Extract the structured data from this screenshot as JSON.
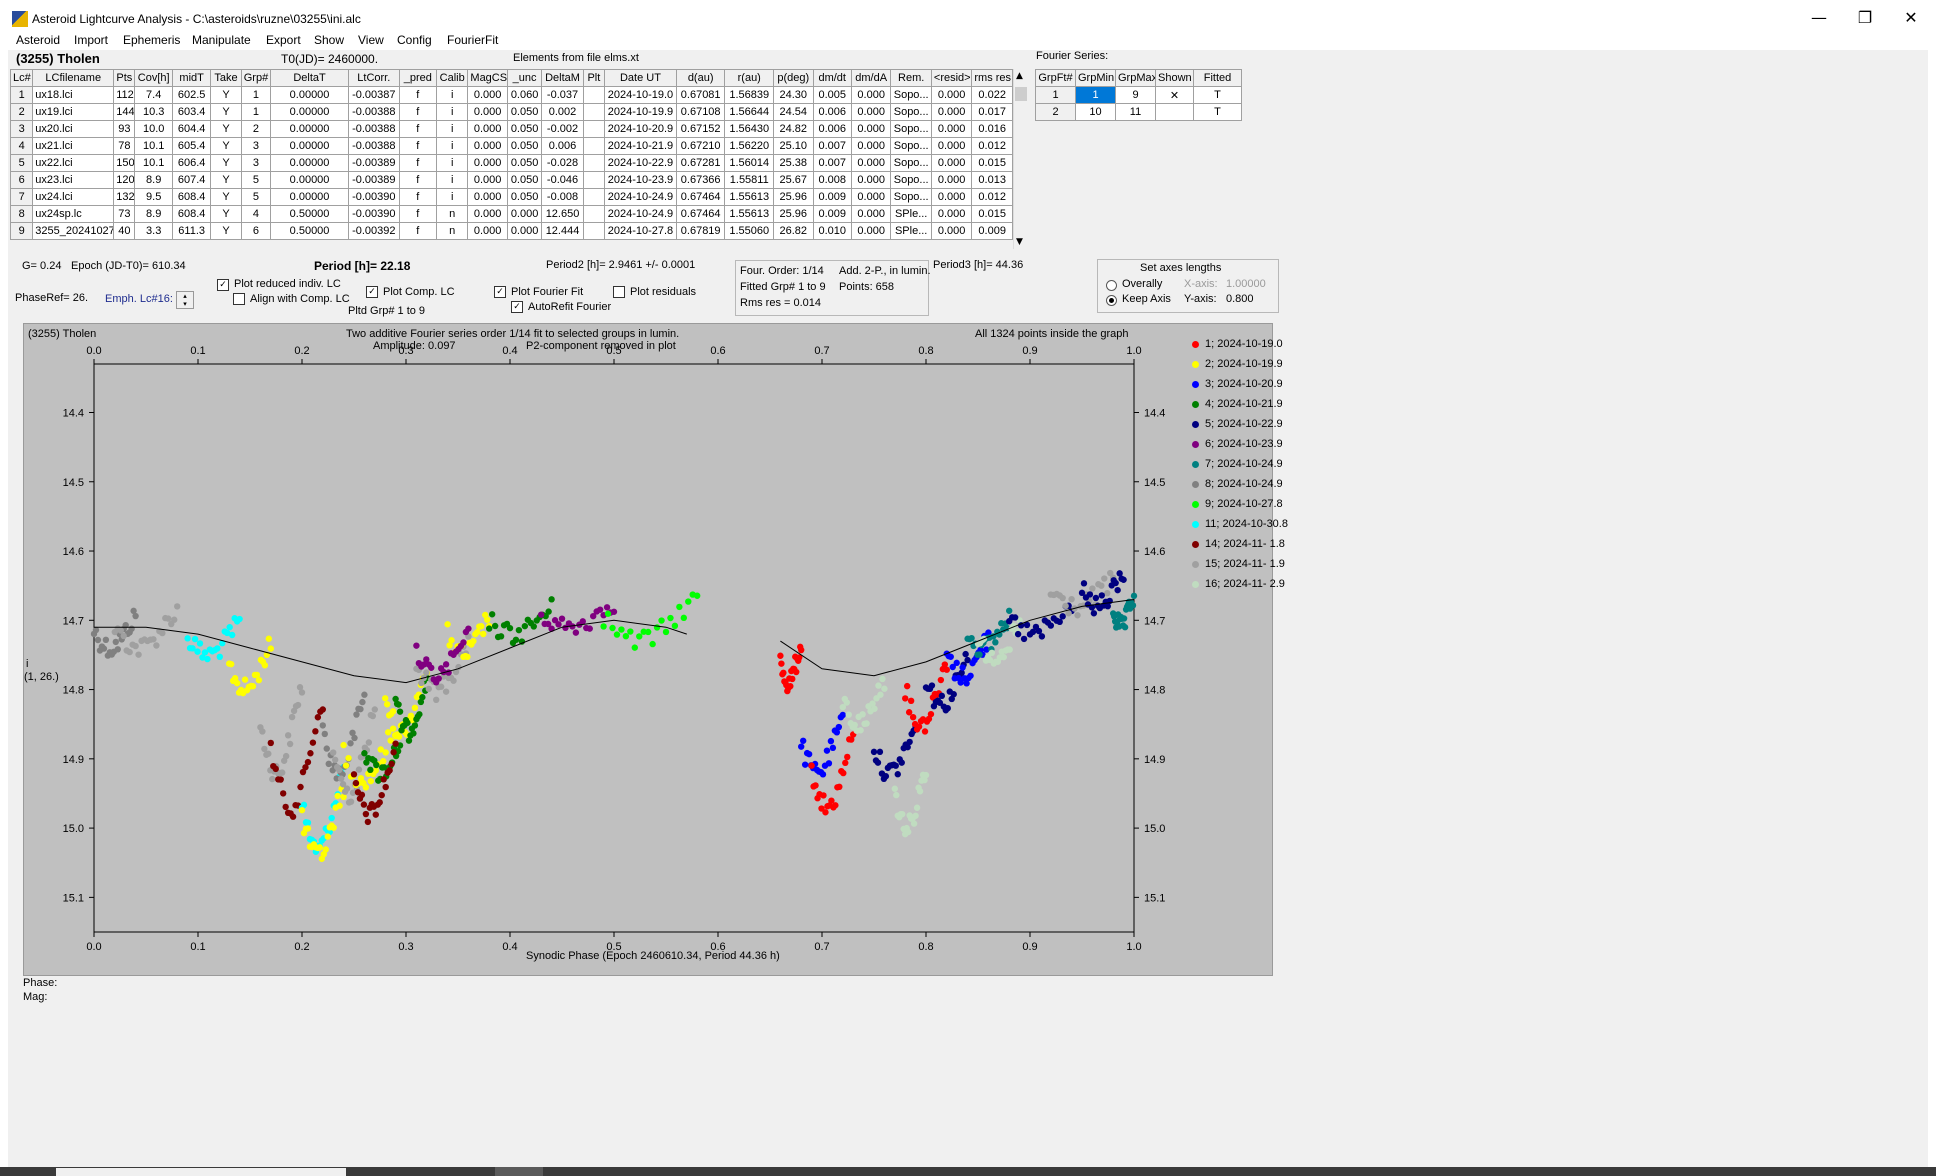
{
  "window": {
    "title": "Asteroid Lightcurve Analysis - C:\\asteroids\\ruzne\\03255\\ini.alc",
    "minimize": "—",
    "restore": "❐",
    "close": "✕"
  },
  "menu": [
    "Asteroid",
    "Import",
    "Ephemeris",
    "Manipulate",
    "Export",
    "Show",
    "View",
    "Config",
    "FourierFit"
  ],
  "header": {
    "asteroid": "(3255) Tholen",
    "t0": "T0(JD)= 2460000.",
    "elements": "Elements from file elms.xt"
  },
  "lc_table": {
    "columns": [
      "Lc#",
      "LCfilename",
      "Pts",
      "Cov[h]",
      "midT",
      "Take",
      "Grp#",
      "DeltaT",
      "LtCorr.",
      "_pred",
      "Calib",
      "MagCS",
      "_unc",
      "DeltaM",
      "Plt",
      "Date UT",
      "d(au)",
      "r(au)",
      "p(deg)",
      "dm/dt",
      "dm/dA",
      "Rem.",
      "<resid>",
      "rms res"
    ],
    "rows": [
      [
        "1",
        "ux18.lci",
        "112",
        "7.4",
        "602.5",
        "Y",
        "1",
        "0.00000",
        "-0.00387",
        "f",
        "i",
        "0.000",
        "0.060",
        "-0.037",
        "",
        "2024-10-19.0",
        "0.67081",
        "1.56839",
        "24.30",
        "0.005",
        "0.000",
        "Sopo...",
        "0.000",
        "0.022"
      ],
      [
        "2",
        "ux19.lci",
        "144",
        "10.3",
        "603.4",
        "Y",
        "1",
        "0.00000",
        "-0.00388",
        "f",
        "i",
        "0.000",
        "0.050",
        "0.002",
        "",
        "2024-10-19.9",
        "0.67108",
        "1.56644",
        "24.54",
        "0.006",
        "0.000",
        "Sopo...",
        "0.000",
        "0.017"
      ],
      [
        "3",
        "ux20.lci",
        "93",
        "10.0",
        "604.4",
        "Y",
        "2",
        "0.00000",
        "-0.00388",
        "f",
        "i",
        "0.000",
        "0.050",
        "-0.002",
        "",
        "2024-10-20.9",
        "0.67152",
        "1.56430",
        "24.82",
        "0.006",
        "0.000",
        "Sopo...",
        "0.000",
        "0.016"
      ],
      [
        "4",
        "ux21.lci",
        "78",
        "10.1",
        "605.4",
        "Y",
        "3",
        "0.00000",
        "-0.00388",
        "f",
        "i",
        "0.000",
        "0.050",
        "0.006",
        "",
        "2024-10-21.9",
        "0.67210",
        "1.56220",
        "25.10",
        "0.007",
        "0.000",
        "Sopo...",
        "0.000",
        "0.012"
      ],
      [
        "5",
        "ux22.lci",
        "150",
        "10.1",
        "606.4",
        "Y",
        "3",
        "0.00000",
        "-0.00389",
        "f",
        "i",
        "0.000",
        "0.050",
        "-0.028",
        "",
        "2024-10-22.9",
        "0.67281",
        "1.56014",
        "25.38",
        "0.007",
        "0.000",
        "Sopo...",
        "0.000",
        "0.015"
      ],
      [
        "6",
        "ux23.lci",
        "120",
        "8.9",
        "607.4",
        "Y",
        "5",
        "0.00000",
        "-0.00389",
        "f",
        "i",
        "0.000",
        "0.050",
        "-0.046",
        "",
        "2024-10-23.9",
        "0.67366",
        "1.55811",
        "25.67",
        "0.008",
        "0.000",
        "Sopo...",
        "0.000",
        "0.013"
      ],
      [
        "7",
        "ux24.lci",
        "132",
        "9.5",
        "608.4",
        "Y",
        "5",
        "0.00000",
        "-0.00390",
        "f",
        "i",
        "0.000",
        "0.050",
        "-0.008",
        "",
        "2024-10-24.9",
        "0.67464",
        "1.55613",
        "25.96",
        "0.009",
        "0.000",
        "Sopo...",
        "0.000",
        "0.012"
      ],
      [
        "8",
        "ux24sp.lc",
        "73",
        "8.9",
        "608.4",
        "Y",
        "4",
        "0.50000",
        "-0.00390",
        "f",
        "n",
        "0.000",
        "0.000",
        "12.650",
        "",
        "2024-10-24.9",
        "0.67464",
        "1.55613",
        "25.96",
        "0.009",
        "0.000",
        "SPle...",
        "0.000",
        "0.015"
      ],
      [
        "9",
        "3255_20241027",
        "40",
        "3.3",
        "611.3",
        "Y",
        "6",
        "0.50000",
        "-0.00392",
        "f",
        "n",
        "0.000",
        "0.000",
        "12.444",
        "",
        "2024-10-27.8",
        "0.67819",
        "1.55060",
        "26.82",
        "0.010",
        "0.000",
        "SPle...",
        "0.000",
        "0.009"
      ]
    ]
  },
  "fourier_series": {
    "title": "Fourier Series:",
    "columns": [
      "GrpFt#",
      "GrpMin",
      "GrpMax",
      "Shown",
      "Fitted"
    ],
    "rows": [
      [
        "1",
        "1",
        "9",
        "✕",
        "T"
      ],
      [
        "2",
        "10",
        "11",
        "",
        "T"
      ]
    ]
  },
  "controls": {
    "g": "G= 0.24",
    "epoch": "Epoch (JD-T0)= 610.34",
    "period": "Period [h]= 22.18",
    "period2": "Period2 [h]= 2.9461 +/- 0.0001",
    "period3": "Period3 [h]= 44.36",
    "phaseref": "PhaseRef= 26.",
    "emph": "Emph. Lc#16:",
    "plot_reduced": "Plot reduced indiv. LC",
    "align": "Align with Comp. LC",
    "plot_comp": "Plot Comp. LC",
    "pltd_grp": "Pltd Grp#  1   to   9",
    "plot_fourier": "Plot Fourier Fit",
    "autorefit": "AutoRefit Fourier",
    "plot_resid": "Plot residuals",
    "four_order": "Four. Order:  1/14",
    "add2p": "Add. 2-P., in lumin.",
    "fitted": "Fitted Grp# 1 to 9",
    "points": "Points: 658",
    "rms": "Rms res     = 0.014",
    "axes_title": "Set axes lengths",
    "overally": "Overally",
    "keep": "Keep Axis",
    "xaxis": "X-axis:",
    "xval": "1.00000",
    "yaxis": "Y-axis:",
    "yval": "0.800"
  },
  "plot": {
    "name": "(3255) Tholen",
    "info1": "Two additive Fourier series order 1/14 fit to selected groups in lumin.",
    "info2": "Amplitude: 0.097",
    "info3": "P2-component removed in plot",
    "points_info": "All 1324 points inside the graph",
    "ylabel1": "i",
    "ylabel2": "(1, 26.)",
    "xlabel": "Synodic Phase (Epoch 2460610.34, Period 44.36 h)",
    "phase": "Phase:",
    "mag": "Mag:"
  },
  "chart_data": {
    "type": "scatter",
    "x_ticks": [
      "0.0",
      "0.1",
      "0.2",
      "0.3",
      "0.4",
      "0.5",
      "0.6",
      "0.7",
      "0.8",
      "0.9",
      "1.0"
    ],
    "y_ticks": [
      "14.4",
      "14.5",
      "14.6",
      "14.7",
      "14.8",
      "14.9",
      "15.0",
      "15.1"
    ],
    "xlim": [
      0,
      1
    ],
    "ylim": [
      14.33,
      15.15
    ],
    "y_inverted": true,
    "series": [
      {
        "name": "1; 2024-10-19.0",
        "color": "#ff0000"
      },
      {
        "name": "2; 2024-10-19.9",
        "color": "#ffff00"
      },
      {
        "name": "3; 2024-10-20.9",
        "color": "#0000ff"
      },
      {
        "name": "4; 2024-10-21.9",
        "color": "#008000"
      },
      {
        "name": "5; 2024-10-22.9",
        "color": "#000080"
      },
      {
        "name": "6; 2024-10-23.9",
        "color": "#800080"
      },
      {
        "name": "7; 2024-10-24.9",
        "color": "#008080"
      },
      {
        "name": "8; 2024-10-24.9",
        "color": "#808080"
      },
      {
        "name": "9; 2024-10-27.8",
        "color": "#00ff00"
      },
      {
        "name": "11; 2024-10-30.8",
        "color": "#00ffff"
      },
      {
        "name": "14; 2024-11- 1.8",
        "color": "#800000"
      },
      {
        "name": "15; 2024-11- 1.9",
        "color": "#a0a0a0"
      },
      {
        "name": "16; 2024-11- 2.9",
        "color": "#c0dcc0"
      }
    ],
    "fit_curve": [
      [
        0.0,
        14.71
      ],
      [
        0.05,
        14.71
      ],
      [
        0.1,
        14.72
      ],
      [
        0.15,
        14.74
      ],
      [
        0.2,
        14.76
      ],
      [
        0.25,
        14.78
      ],
      [
        0.3,
        14.79
      ],
      [
        0.35,
        14.77
      ],
      [
        0.4,
        14.74
      ],
      [
        0.45,
        14.71
      ],
      [
        0.5,
        14.7
      ],
      [
        0.55,
        14.71
      ],
      [
        0.57,
        14.72
      ]
    ],
    "fit_curve2": [
      [
        0.66,
        14.73
      ],
      [
        0.7,
        14.77
      ],
      [
        0.75,
        14.78
      ],
      [
        0.8,
        14.76
      ],
      [
        0.85,
        14.73
      ],
      [
        0.9,
        14.7
      ],
      [
        0.95,
        14.68
      ],
      [
        1.0,
        14.67
      ]
    ],
    "segments": [
      {
        "s": 7,
        "x0": 0.0,
        "x1": 0.04,
        "y": [
          14.69,
          14.74
        ]
      },
      {
        "s": 11,
        "x0": 0.02,
        "x1": 0.08,
        "y": [
          14.68,
          14.74
        ]
      },
      {
        "s": 9,
        "x0": 0.09,
        "x1": 0.14,
        "y": [
          14.7,
          14.75
        ]
      },
      {
        "s": 1,
        "x0": 0.13,
        "x1": 0.17,
        "y": [
          14.73,
          14.8
        ]
      },
      {
        "s": 11,
        "x0": 0.16,
        "x1": 0.2,
        "y": [
          14.78,
          14.92
        ]
      },
      {
        "s": 10,
        "x0": 0.17,
        "x1": 0.22,
        "y": [
          14.8,
          14.97
        ]
      },
      {
        "s": 9,
        "x0": 0.2,
        "x1": 0.24,
        "y": [
          14.9,
          15.03
        ]
      },
      {
        "s": 1,
        "x0": 0.2,
        "x1": 0.24,
        "y": [
          14.93,
          15.04
        ]
      },
      {
        "s": 7,
        "x0": 0.22,
        "x1": 0.26,
        "y": [
          14.8,
          14.92
        ]
      },
      {
        "s": 11,
        "x0": 0.23,
        "x1": 0.27,
        "y": [
          14.82,
          14.95
        ]
      },
      {
        "s": 1,
        "x0": 0.24,
        "x1": 0.29,
        "y": [
          14.85,
          14.93
        ]
      },
      {
        "s": 3,
        "x0": 0.26,
        "x1": 0.3,
        "y": [
          14.85,
          14.92
        ]
      },
      {
        "s": 10,
        "x0": 0.25,
        "x1": 0.29,
        "y": [
          14.88,
          14.98
        ]
      },
      {
        "s": 1,
        "x0": 0.28,
        "x1": 0.32,
        "y": [
          14.76,
          14.86
        ]
      },
      {
        "s": 3,
        "x0": 0.29,
        "x1": 0.32,
        "y": [
          14.78,
          14.86
        ]
      },
      {
        "s": 11,
        "x0": 0.31,
        "x1": 0.36,
        "y": [
          14.73,
          14.8
        ]
      },
      {
        "s": 1,
        "x0": 0.34,
        "x1": 0.38,
        "y": [
          14.69,
          14.75
        ]
      },
      {
        "s": 5,
        "x0": 0.31,
        "x1": 0.36,
        "y": [
          14.72,
          14.78
        ]
      },
      {
        "s": 3,
        "x0": 0.38,
        "x1": 0.44,
        "y": [
          14.68,
          14.72
        ]
      },
      {
        "s": 5,
        "x0": 0.43,
        "x1": 0.5,
        "y": [
          14.67,
          14.71
        ]
      },
      {
        "s": 8,
        "x0": 0.49,
        "x1": 0.58,
        "y": [
          14.66,
          14.73
        ]
      },
      {
        "s": 0,
        "x0": 0.66,
        "x1": 0.68,
        "y": [
          14.73,
          14.79
        ]
      },
      {
        "s": 2,
        "x0": 0.68,
        "x1": 0.72,
        "y": [
          14.84,
          14.92
        ]
      },
      {
        "s": 0,
        "x0": 0.69,
        "x1": 0.73,
        "y": [
          14.86,
          14.97
        ]
      },
      {
        "s": 12,
        "x0": 0.72,
        "x1": 0.76,
        "y": [
          14.78,
          14.85
        ]
      },
      {
        "s": 4,
        "x0": 0.75,
        "x1": 0.79,
        "y": [
          14.85,
          14.92
        ]
      },
      {
        "s": 12,
        "x0": 0.77,
        "x1": 0.8,
        "y": [
          14.9,
          15.0
        ]
      },
      {
        "s": 0,
        "x0": 0.78,
        "x1": 0.82,
        "y": [
          14.75,
          14.85
        ]
      },
      {
        "s": 4,
        "x0": 0.8,
        "x1": 0.84,
        "y": [
          14.75,
          14.82
        ]
      },
      {
        "s": 2,
        "x0": 0.82,
        "x1": 0.86,
        "y": [
          14.72,
          14.78
        ]
      },
      {
        "s": 6,
        "x0": 0.84,
        "x1": 0.88,
        "y": [
          14.69,
          14.74
        ]
      },
      {
        "s": 12,
        "x0": 0.85,
        "x1": 0.89,
        "y": [
          14.71,
          14.75
        ]
      },
      {
        "s": 4,
        "x0": 0.88,
        "x1": 0.94,
        "y": [
          14.68,
          14.72
        ]
      },
      {
        "s": 11,
        "x0": 0.92,
        "x1": 0.98,
        "y": [
          14.64,
          14.68
        ]
      },
      {
        "s": 4,
        "x0": 0.95,
        "x1": 0.99,
        "y": [
          14.63,
          14.68
        ]
      },
      {
        "s": 6,
        "x0": 0.98,
        "x1": 1.0,
        "y": [
          14.66,
          14.71
        ]
      }
    ]
  }
}
